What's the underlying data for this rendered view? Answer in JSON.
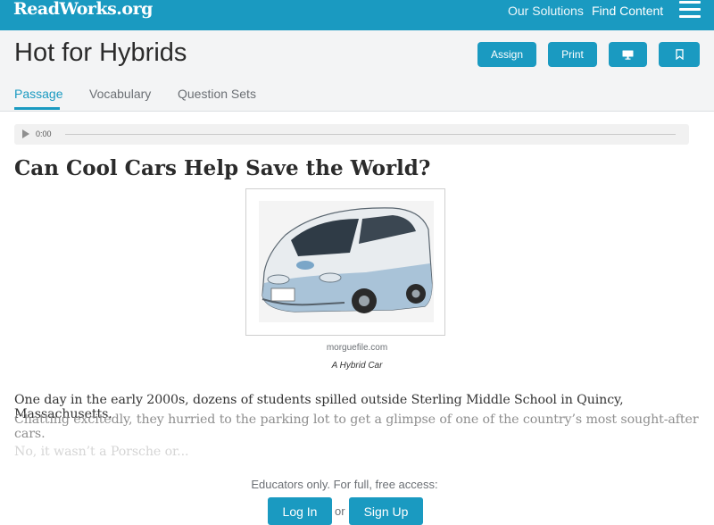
{
  "topbar": {
    "logo": "ReadWorks.org",
    "nav": {
      "our_solutions": "Our Solutions",
      "find_content": "Find Content"
    },
    "menu_icon": "hamburger-menu-icon",
    "color": "#1a9ac1"
  },
  "header": {
    "title": "Hot for Hybrids",
    "buttons": {
      "assign": "Assign",
      "print": "Print",
      "present_icon": "monitor-icon",
      "bookmark_icon": "bookmark-icon"
    },
    "tabs": [
      {
        "label": "Passage",
        "active": true
      },
      {
        "label": "Vocabulary",
        "active": false
      },
      {
        "label": "Question Sets",
        "active": false
      }
    ]
  },
  "audio": {
    "time": "0:00",
    "play_icon": "play-icon"
  },
  "article": {
    "title": "Can Cool Cars Help Save the World?",
    "image": {
      "credit": "morguefile.com",
      "caption": "A Hybrid Car"
    },
    "paragraph1_line1": "One day in the early 2000s, dozens of students spilled outside Sterling Middle School in Quincy, Massachusetts.",
    "paragraph1_line2": "Chatting excitedly, they hurried to the parking lot to get a glimpse of one of the country’s most sought-after cars.",
    "paragraph2": "No, it wasn’t a Porsche or..."
  },
  "access": {
    "message": "Educators only. For full, free access:",
    "login": "Log In",
    "or": "or",
    "signup": "Sign Up"
  }
}
